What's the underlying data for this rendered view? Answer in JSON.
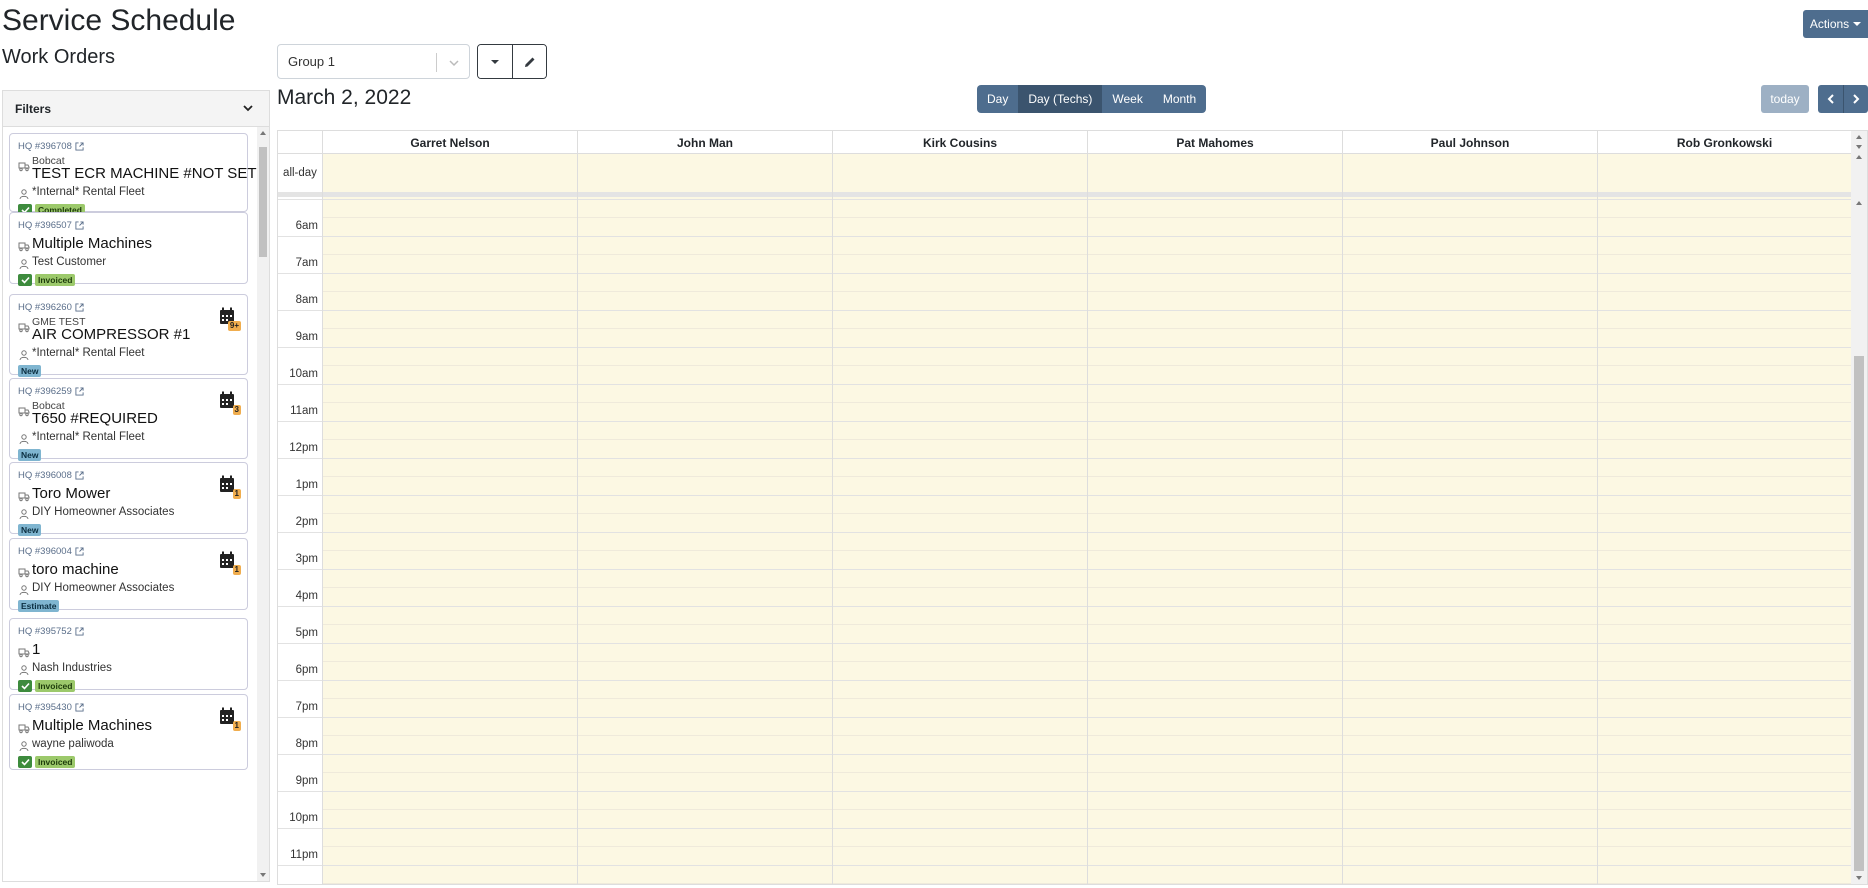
{
  "page": {
    "title": "Service Schedule",
    "subtitle": "Work Orders"
  },
  "toolbar": {
    "group_value": "Group 1",
    "actions_label": "Actions"
  },
  "filters": {
    "label": "Filters"
  },
  "work_orders": [
    {
      "hq": "HQ #396708",
      "make": "Bobcat",
      "title": "TEST ECR MACHINE #NOT SET",
      "customer": "*Internal* Rental Fleet",
      "status": "Completed",
      "status_color": "green",
      "checked": true,
      "cal_count": ""
    },
    {
      "hq": "HQ #396507",
      "make": "",
      "title": "Multiple Machines",
      "customer": "Test Customer",
      "status": "Invoiced",
      "status_color": "green",
      "checked": true,
      "cal_count": ""
    },
    {
      "hq": "HQ #396260",
      "make": "GME TEST",
      "title": "AIR COMPRESSOR #1",
      "customer": "*Internal* Rental Fleet",
      "status": "New",
      "status_color": "blue",
      "checked": false,
      "cal_count": "9+"
    },
    {
      "hq": "HQ #396259",
      "make": "Bobcat",
      "title": "T650 #REQUIRED",
      "customer": "*Internal* Rental Fleet",
      "status": "New",
      "status_color": "blue",
      "checked": false,
      "cal_count": "3"
    },
    {
      "hq": "HQ #396008",
      "make": "",
      "title": "Toro Mower",
      "customer": "DIY Homeowner Associates",
      "status": "New",
      "status_color": "blue",
      "checked": false,
      "cal_count": "1"
    },
    {
      "hq": "HQ #396004",
      "make": "",
      "title": "toro machine",
      "customer": "DIY Homeowner Associates",
      "status": "Estimate",
      "status_color": "blue",
      "checked": false,
      "cal_count": "1"
    },
    {
      "hq": "HQ #395752",
      "make": "",
      "title": "1",
      "customer": "Nash Industries",
      "status": "Invoiced",
      "status_color": "green",
      "checked": true,
      "cal_count": ""
    },
    {
      "hq": "HQ #395430",
      "make": "",
      "title": "Multiple Machines",
      "customer": "wayne paliwoda",
      "status": "Invoiced",
      "status_color": "green",
      "checked": true,
      "cal_count": "1"
    }
  ],
  "calendar": {
    "date": "March 2, 2022",
    "views": [
      "Day",
      "Day (Techs)",
      "Week",
      "Month"
    ],
    "active_view": "Day (Techs)",
    "today_label": "today",
    "all_day_label": "all-day",
    "technicians": [
      "Garret Nelson",
      "John Man",
      "Kirk Cousins",
      "Pat Mahomes",
      "Paul Johnson",
      "Rob Gronkowski"
    ],
    "times": [
      "6am",
      "7am",
      "8am",
      "9am",
      "10am",
      "11am",
      "12pm",
      "1pm",
      "2pm",
      "3pm",
      "4pm",
      "5pm",
      "6pm",
      "7pm",
      "8pm",
      "9pm",
      "10pm",
      "11pm"
    ]
  },
  "colors": {
    "accent": "#4e6d8e",
    "accent_active": "#3b546e",
    "slot_bg": "#fcf8e3",
    "today_btn": "#9db0c4",
    "status_green": "#9cc96b",
    "status_blue": "#7fb5d0",
    "cal_count": "#f0ad4e"
  }
}
